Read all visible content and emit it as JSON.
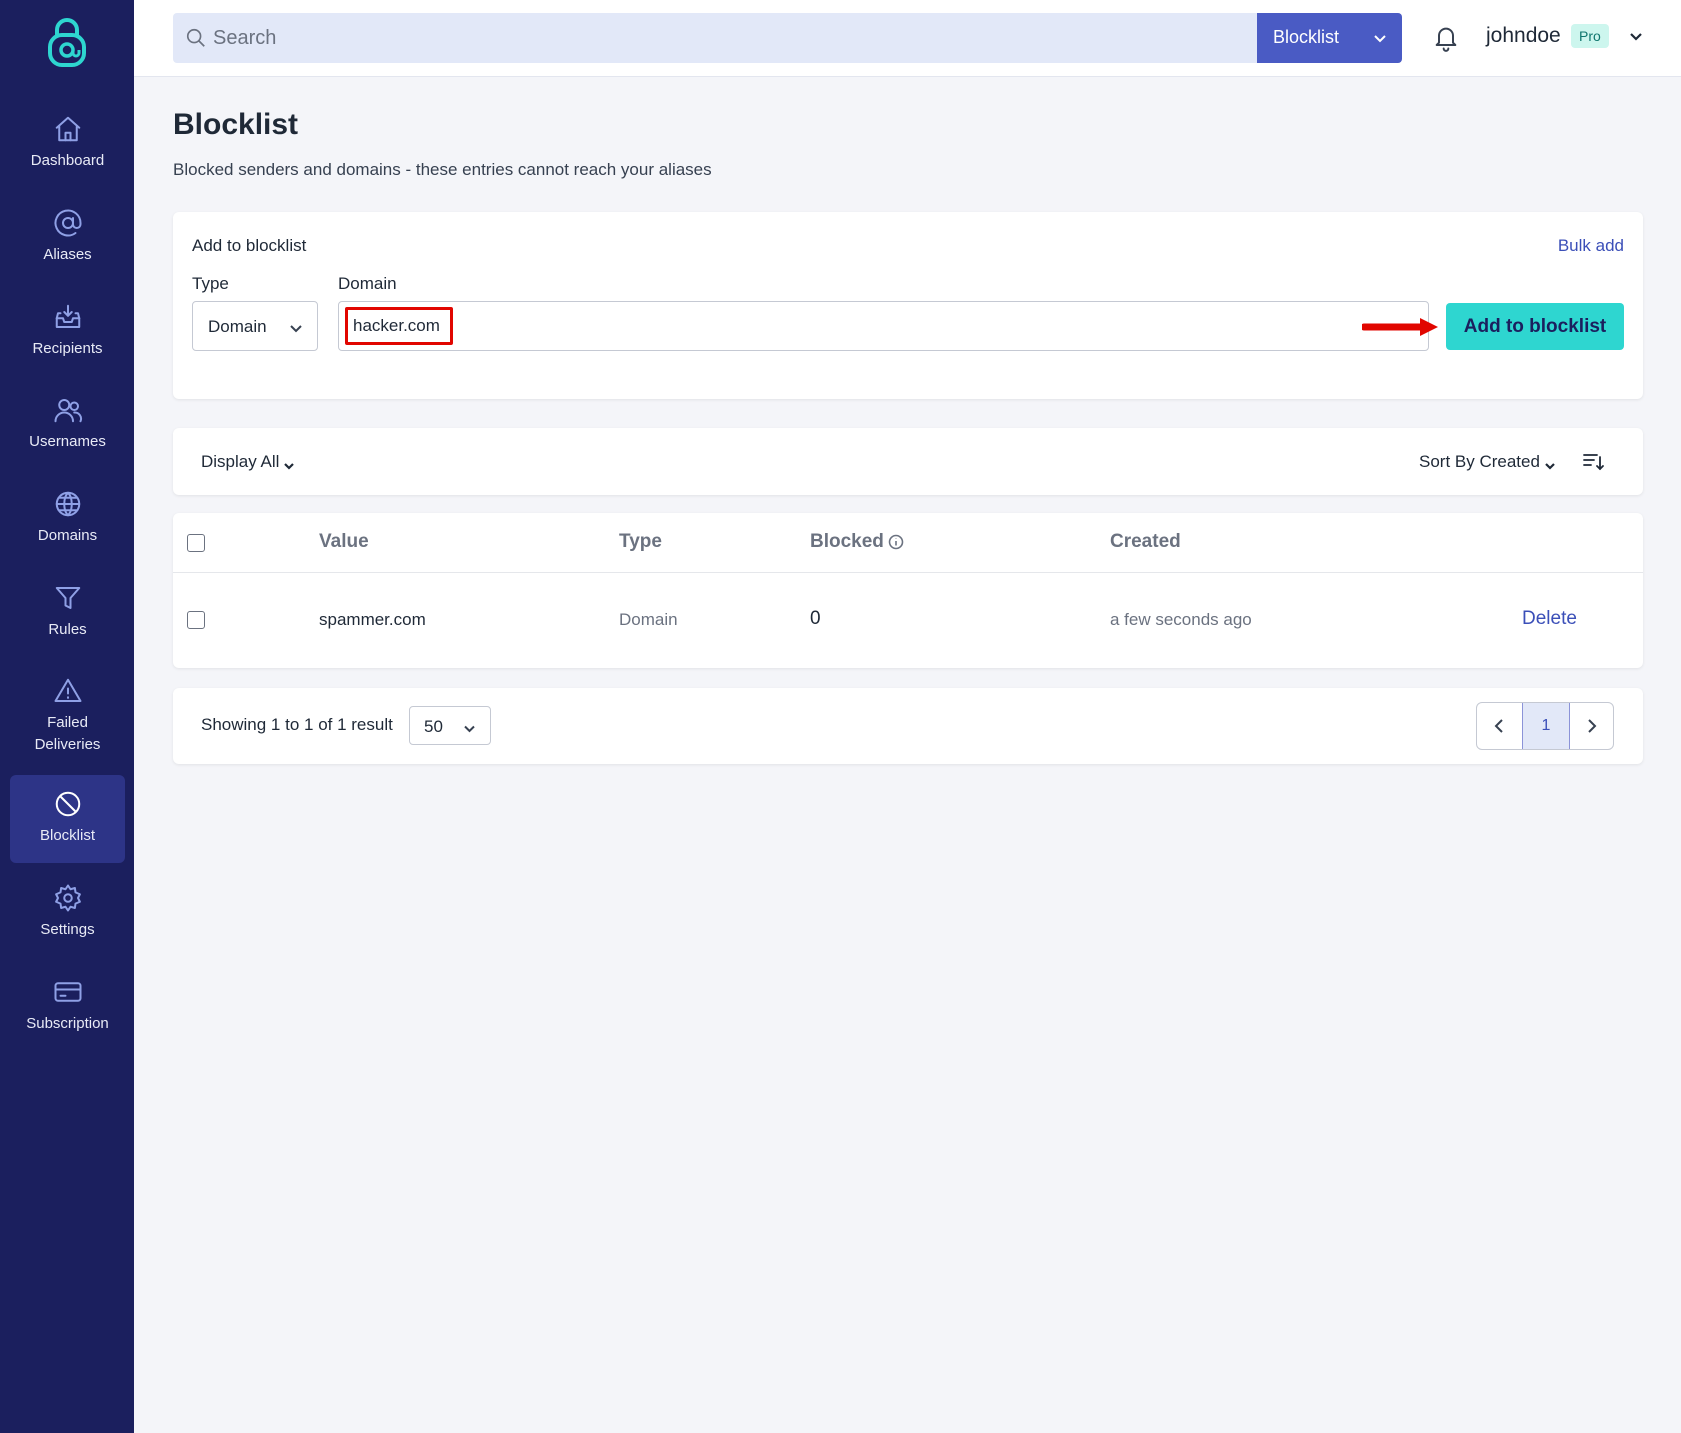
{
  "app": {
    "accent_color": "#2ed6d0",
    "sidebar_color": "#1b1f5e",
    "logo_icon": "padlock-at-icon"
  },
  "sidebar": {
    "items": [
      {
        "label": "Dashboard",
        "icon": "home-icon"
      },
      {
        "label": "Aliases",
        "icon": "at-sign-icon"
      },
      {
        "label": "Recipients",
        "icon": "inbox-icon"
      },
      {
        "label": "Usernames",
        "icon": "users-icon"
      },
      {
        "label": "Domains",
        "icon": "globe-icon"
      },
      {
        "label": "Rules",
        "icon": "filter-icon"
      },
      {
        "label": "Failed\nDeliveries",
        "icon": "warning-icon"
      },
      {
        "label": "Blocklist",
        "icon": "ban-icon",
        "active": true
      },
      {
        "label": "Settings",
        "icon": "gear-icon"
      },
      {
        "label": "Subscription",
        "icon": "credit-card-icon"
      }
    ]
  },
  "header": {
    "search_placeholder": "Search",
    "search_scope": "Blocklist",
    "username": "johndoe",
    "plan_badge": "Pro"
  },
  "page": {
    "title": "Blocklist",
    "subtitle": "Blocked senders and domains - these entries cannot reach your aliases"
  },
  "add_form": {
    "title": "Add to blocklist",
    "bulk_add": "Bulk add",
    "type_label": "Type",
    "type_value": "Domain",
    "domain_label": "Domain",
    "domain_value": "hacker.com",
    "submit_label": "Add to blocklist"
  },
  "filters": {
    "display": "Display All",
    "sort": "Sort By Created"
  },
  "table": {
    "columns": [
      "Value",
      "Type",
      "Blocked",
      "Created"
    ],
    "rows": [
      {
        "value": "spammer.com",
        "type": "Domain",
        "blocked": "0",
        "created": "a few seconds ago",
        "action": "Delete"
      }
    ]
  },
  "pagination": {
    "showing": "Showing 1 to 1 of 1 result",
    "per_page": "50",
    "current_page": "1"
  }
}
